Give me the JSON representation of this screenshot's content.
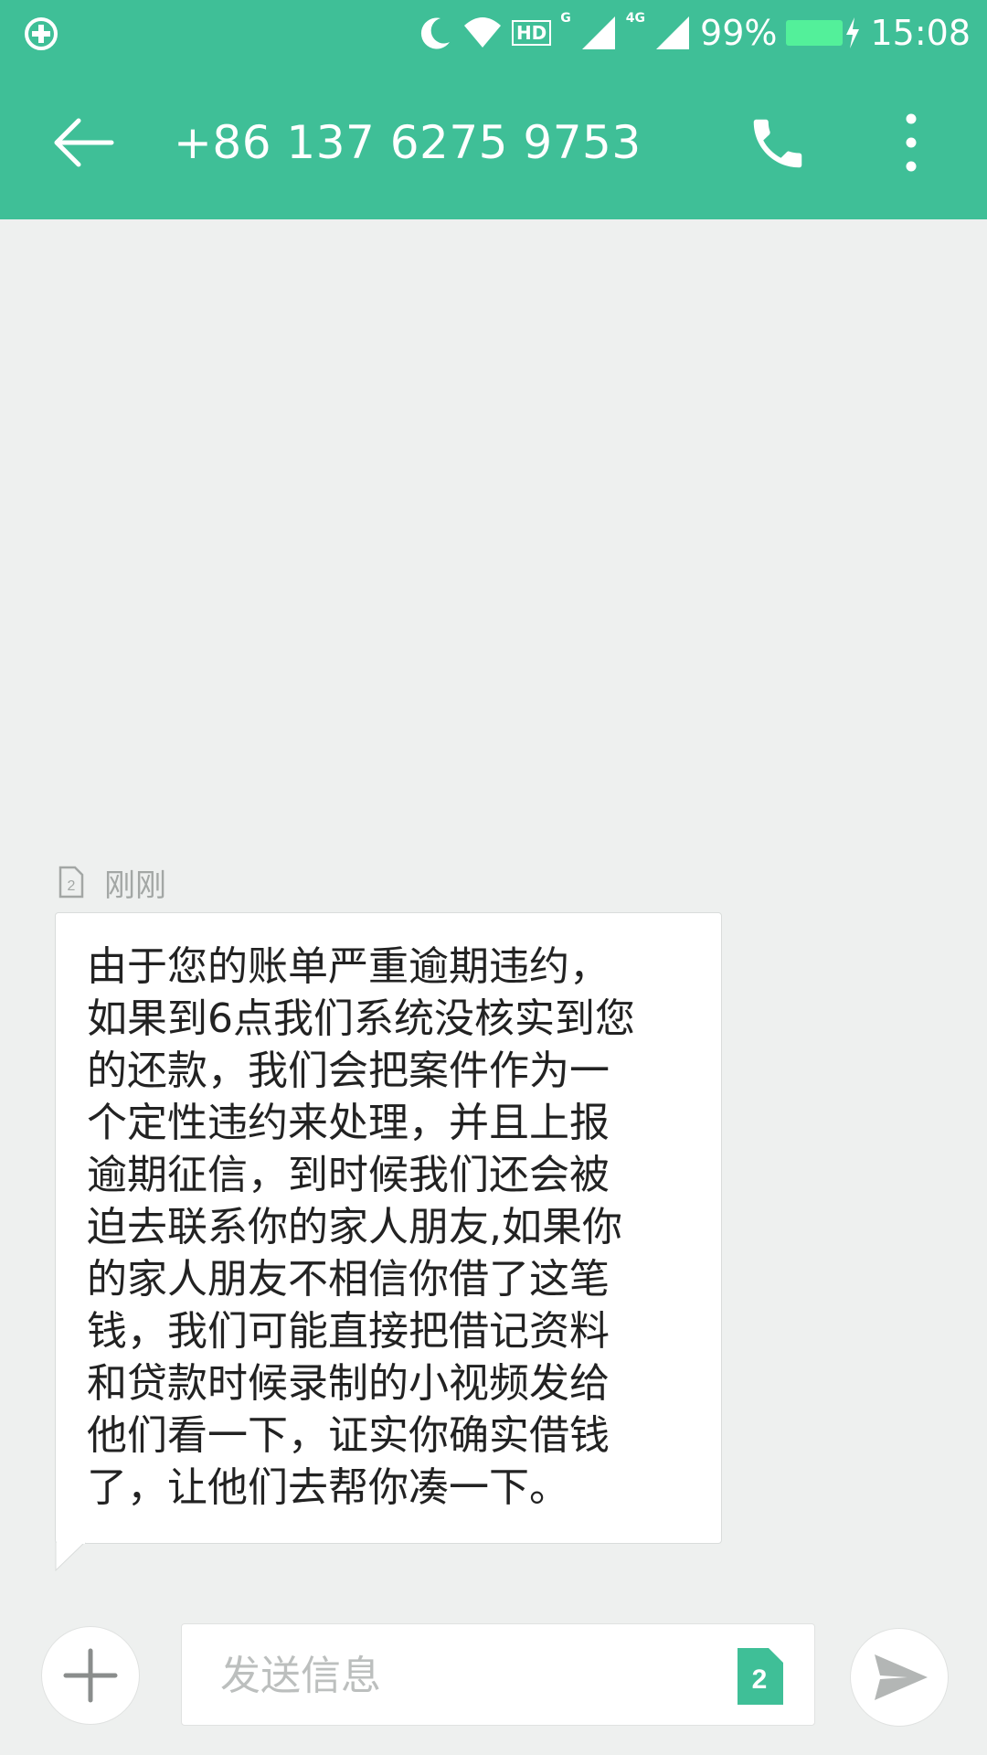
{
  "status_bar": {
    "icons": [
      "plus-circle-icon",
      "moon-icon",
      "wifi-icon",
      "hd-icon",
      "signal-icon",
      "signal-4g-icon",
      "battery-icon",
      "charging-icon"
    ],
    "hd_label": "HD",
    "network_g": "G",
    "network_4g": "4G",
    "battery": "99%",
    "battery_level": 0.99,
    "time": "15:08"
  },
  "header": {
    "title": "+86 137 6275 9753",
    "icons": [
      "back-arrow-icon",
      "phone-icon",
      "more-vert-icon"
    ]
  },
  "conversation": {
    "messages": [
      {
        "sim_label": "2",
        "timestamp": "刚刚",
        "text": "由于您的账单严重逾期违约，\n如果到6点我们系统没核实到您\n的还款，我们会把案件作为一\n个定性违约来处理，并且上报\n逾期征信，到时候我们还会被\n迫去联系你的家人朋友,如果你\n的家人朋友不相信你借了这笔\n钱，我们可能直接把借记资料\n和贷款时候录制的小视频发给\n他们看一下，证实你确实借钱\n了，让他们去帮你凑一下。"
      }
    ]
  },
  "composer": {
    "placeholder": "发送信息",
    "sim_label": "2",
    "icons": [
      "plus-icon",
      "sim-card-icon",
      "send-icon"
    ]
  },
  "colors": {
    "accent": "#3fbf97",
    "background": "#eef0ef",
    "bubble": "#ffffff"
  }
}
